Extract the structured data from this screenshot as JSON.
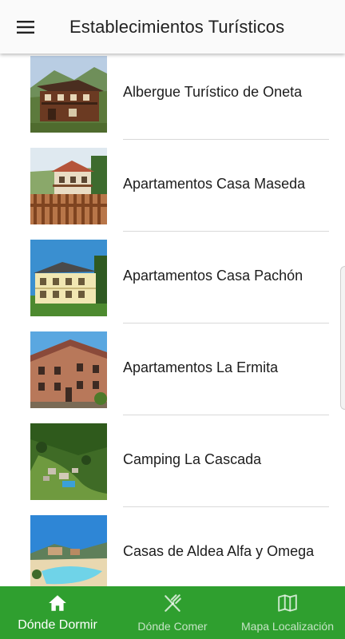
{
  "app_bar": {
    "title": "Establecimientos Turísticos",
    "menu_icon": "hamburger-menu-icon"
  },
  "establishments": [
    {
      "name": "Albergue Turístico de Oneta",
      "thumbnail": "building-photo"
    },
    {
      "name": "Apartamentos Casa Maseda",
      "thumbnail": "building-photo"
    },
    {
      "name": "Apartamentos Casa Pachón",
      "thumbnail": "building-photo"
    },
    {
      "name": "Apartamentos La Ermita",
      "thumbnail": "building-photo"
    },
    {
      "name": "Camping La Cascada",
      "thumbnail": "aerial-photo"
    },
    {
      "name": "Casas de Aldea Alfa y Omega",
      "thumbnail": "pool-photo"
    }
  ],
  "bottom_nav": {
    "items": [
      {
        "label": "Dónde Dormir",
        "icon": "home-icon",
        "active": true
      },
      {
        "label": "Dónde Comer",
        "icon": "fork-knife-icon",
        "active": false
      },
      {
        "label": "Mapa Localización",
        "icon": "map-icon",
        "active": false
      }
    ]
  },
  "colors": {
    "bottom_nav_bg": "#2f9f2f",
    "app_bar_bg": "#fafafa",
    "divider": "#d9d9d9"
  }
}
